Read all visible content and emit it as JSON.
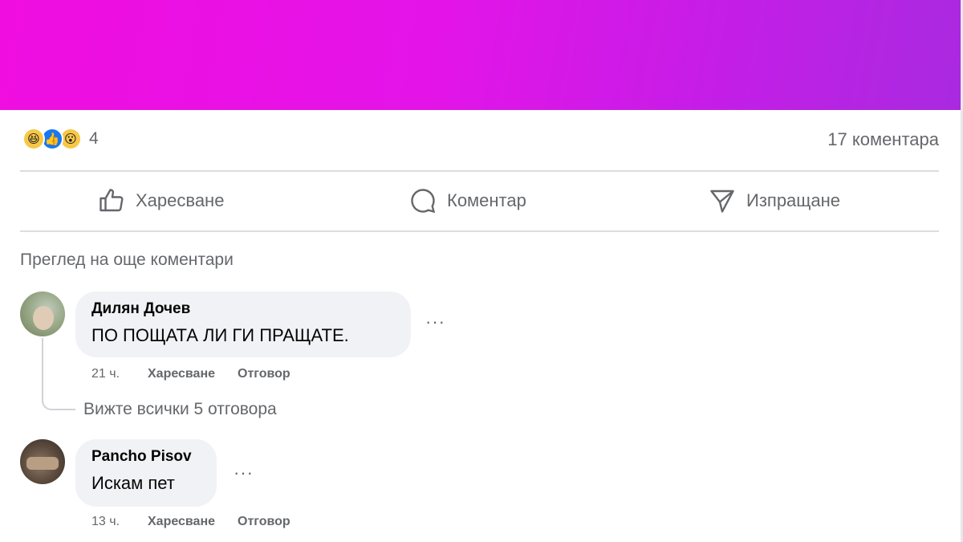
{
  "colors": {
    "banner_start": "#f00de0",
    "banner_end": "#a92ae0",
    "like_blue": "#1877f2",
    "reaction_yellow": "#f7c846"
  },
  "post": {
    "reactions": {
      "icons": [
        "haha-icon",
        "like-icon",
        "wow-icon"
      ],
      "glyphs": [
        "😆",
        "👍",
        "😮"
      ],
      "count": "4"
    },
    "comment_count_label": "17 коментара"
  },
  "actions": {
    "like": "Харесване",
    "comment": "Коментар",
    "share": "Изпращане"
  },
  "more_comments_label": "Преглед на още коментари",
  "comments": [
    {
      "author": "Дилян Дочев",
      "text": "ПО ПОЩАТА ЛИ ГИ ПРАЩАТЕ.",
      "time": "21 ч.",
      "like_label": "Харесване",
      "reply_label": "Отговор",
      "menu": "···",
      "view_replies_label": "Вижте всички 5 отговора"
    },
    {
      "author": "Pancho Pisov",
      "text": "Искам пет",
      "time": "13 ч.",
      "like_label": "Харесване",
      "reply_label": "Отговор",
      "menu": "···"
    }
  ]
}
